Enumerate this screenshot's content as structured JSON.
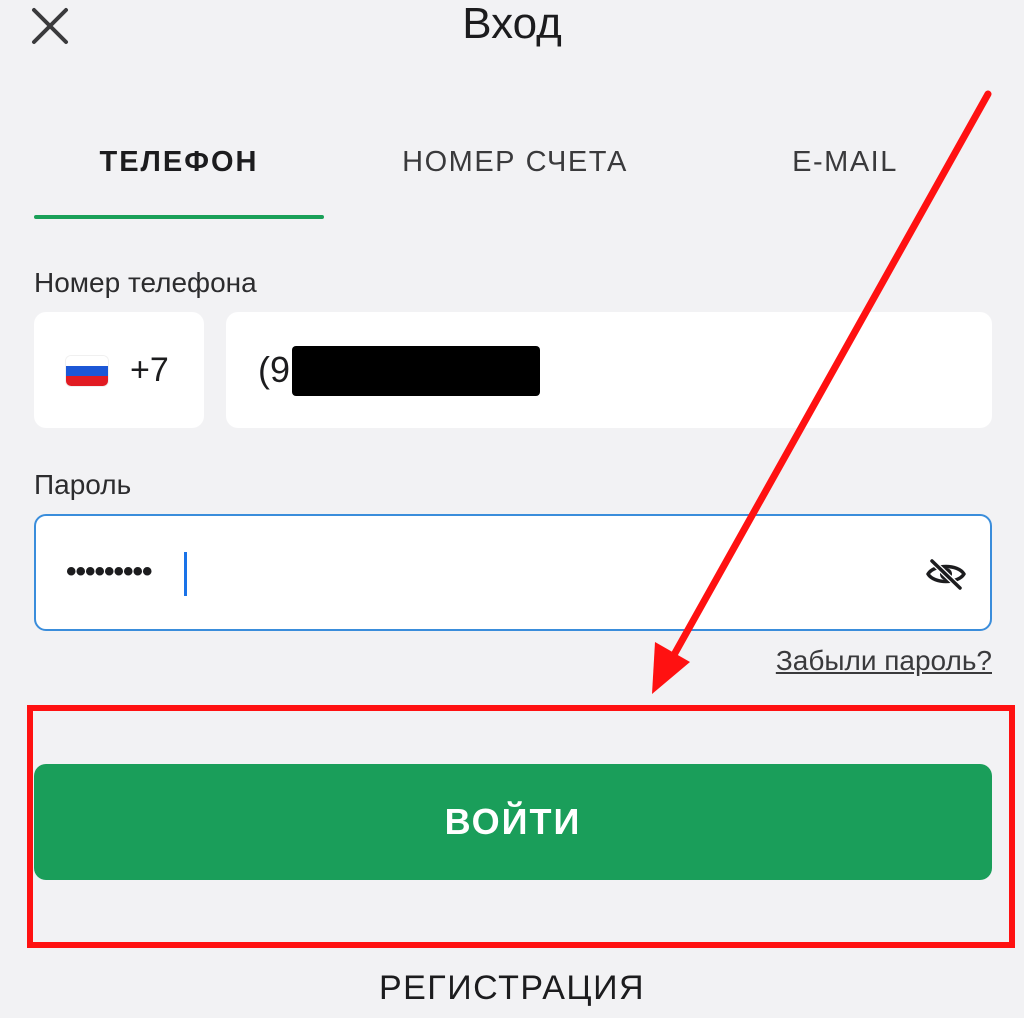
{
  "header": {
    "title": "Вход",
    "close_icon": "close-icon"
  },
  "tabs": [
    {
      "label": "ТЕЛЕФОН",
      "active": true
    },
    {
      "label": "НОМЕР СЧЕТА",
      "active": false
    },
    {
      "label": "E-MAIL",
      "active": false
    }
  ],
  "phone": {
    "label": "Номер телефона",
    "country_flag": "russia-flag-icon",
    "country_code": "+7",
    "value_visible": "(9"
  },
  "password": {
    "label": "Пароль",
    "masked_value": "•••••••••",
    "toggle_icon": "eye-off-icon"
  },
  "forgot_password": "Забыли пароль?",
  "login_button": "ВОЙТИ",
  "register_link": "РЕГИСТРАЦИЯ",
  "colors": {
    "background": "#f2f2f4",
    "accent_green": "#1a9e5a",
    "focus_blue": "#3a8ddb",
    "annotation_red": "#ff1111"
  }
}
